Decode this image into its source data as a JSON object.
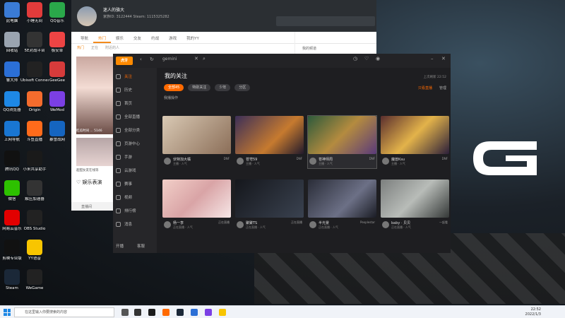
{
  "desktop": {
    "icons": [
      {
        "label": "此电脑",
        "color": "#3a7bd5"
      },
      {
        "label": "小睡无间",
        "color": "#e23b3b"
      },
      {
        "label": "QQ音乐",
        "color": "#2aa84a"
      },
      {
        "label": "回收站",
        "color": "#9aa4b0"
      },
      {
        "label": "5E对战平台",
        "color": "#333"
      },
      {
        "label": "极安卓",
        "color": "#e44"
      },
      {
        "label": "鲁大师",
        "color": "#2b6fd6"
      },
      {
        "label": "Ubisoft Connect",
        "color": "#222"
      },
      {
        "label": "GeeGee",
        "color": "#d63b3b"
      },
      {
        "label": "QQ浏览器",
        "color": "#1e88e5"
      },
      {
        "label": "Origin",
        "color": "#f56c2d"
      },
      {
        "label": "WeMod",
        "color": "#7b3fe4"
      },
      {
        "label": "上网导航",
        "color": "#1976d2"
      },
      {
        "label": "斗鱼直播",
        "color": "#ff6b1b"
      },
      {
        "label": "暴雪战网",
        "color": "#1565c0"
      },
      {
        "label": "腾讯QQ",
        "color": "#111"
      },
      {
        "label": "小米共享助手",
        "color": "#1a1a1a"
      },
      {
        "label": "",
        "color": "transparent"
      },
      {
        "label": "微信",
        "color": "#2dc100"
      },
      {
        "label": "解压加速器",
        "color": "#333"
      },
      {
        "label": "",
        "color": "transparent"
      },
      {
        "label": "网易云音乐",
        "color": "#e20000"
      },
      {
        "label": "OBS Studio",
        "color": "#222"
      },
      {
        "label": "",
        "color": "transparent"
      },
      {
        "label": "剪映专业版",
        "color": "#111"
      },
      {
        "label": "YY语音",
        "color": "#f8c500"
      },
      {
        "label": "",
        "color": "transparent"
      },
      {
        "label": "Steam",
        "color": "#1b2838"
      },
      {
        "label": "WeGame",
        "color": "#222"
      }
    ]
  },
  "yy": {
    "username": "迷人的骆大",
    "ids": "家族ID: 3122444  Steam: 1115325282",
    "tabs": [
      "导航",
      "热门",
      "娱乐",
      "交友",
      "约战",
      "游戏",
      "我的YY"
    ],
    "active_tab": "热门",
    "subtabs": [
      "热门",
      "正在",
      "附近的人"
    ],
    "card1_title": "吃瓜时间 ... 5146",
    "card2_title": "超甜女友在线等",
    "ent_label": "娱乐表演",
    "footer": "直播间",
    "side_label": "我的频道"
  },
  "huya": {
    "logo": "虎牙",
    "search_value": "gemini",
    "side_items": [
      "关注",
      "历史",
      "首页",
      "全部直播",
      "全部分类",
      "页游中心",
      "手游",
      "云游戏",
      "赛事",
      "视频",
      "排行榜",
      "消息"
    ],
    "side_bottom": [
      "开播",
      "客服"
    ],
    "title": "我的关注",
    "tabs": [
      "全部45",
      "特别关注",
      "少年",
      "分区"
    ],
    "sort_label": "我播操作",
    "right_links": [
      "只看直播",
      "管理"
    ],
    "top_time": "上次刷新 22:52",
    "rows": [
      [
        {
          "name": "伏特加大橘",
          "sub": "主播 · 人气",
          "game": "DNF",
          "thumb": "linear-gradient(135deg,#d9c9b4,#8b6e58)"
        },
        {
          "name": "苍穹59",
          "sub": "主播 · 人气",
          "game": "DNF",
          "thumb": "linear-gradient(135deg,#3c2f58,#c67a2f 60%,#221a2c)"
        },
        {
          "name": "苍神师周",
          "sub": "主播 · 人气",
          "game": "DNF",
          "thumb": "linear-gradient(135deg,#2d5a3b,#b48b3f 50%,#5a3a7a)",
          "selected": true
        },
        {
          "name": "魔兽Ksu",
          "sub": "主播 · 人气",
          "game": "DNF",
          "thumb": "linear-gradient(135deg,#5a2e2e,#e3b34a 50%,#2b1f3a)"
        }
      ],
      [
        {
          "name": "杨一李",
          "sub": "正在直播 · 人气",
          "game": "正在直播",
          "thumb": "linear-gradient(135deg,#f2cfc8,#d9a4a6 50%,#f6e6e6)"
        },
        {
          "name": "聚聚TS",
          "sub": "正在直播 · 人气",
          "game": "正在直播",
          "thumb": "linear-gradient(135deg,#15171c,#3a4250)"
        },
        {
          "name": "半光景",
          "sub": "正在直播 · 人气",
          "game": "Peoplestar",
          "thumb": "linear-gradient(135deg,#2a2d38,#6c7086 60%,#1a1c24)"
        },
        {
          "name": "baby · 贝贝",
          "sub": "正在直播 · 人气",
          "game": "一起看",
          "thumb": "linear-gradient(135deg,#7c7f7e,#b8bcb8 50%,#343837)"
        }
      ]
    ]
  },
  "taskbar": {
    "search_placeholder": "在这里输入你要搜索的内容",
    "time": "22:52",
    "date": "2022/1/3"
  }
}
